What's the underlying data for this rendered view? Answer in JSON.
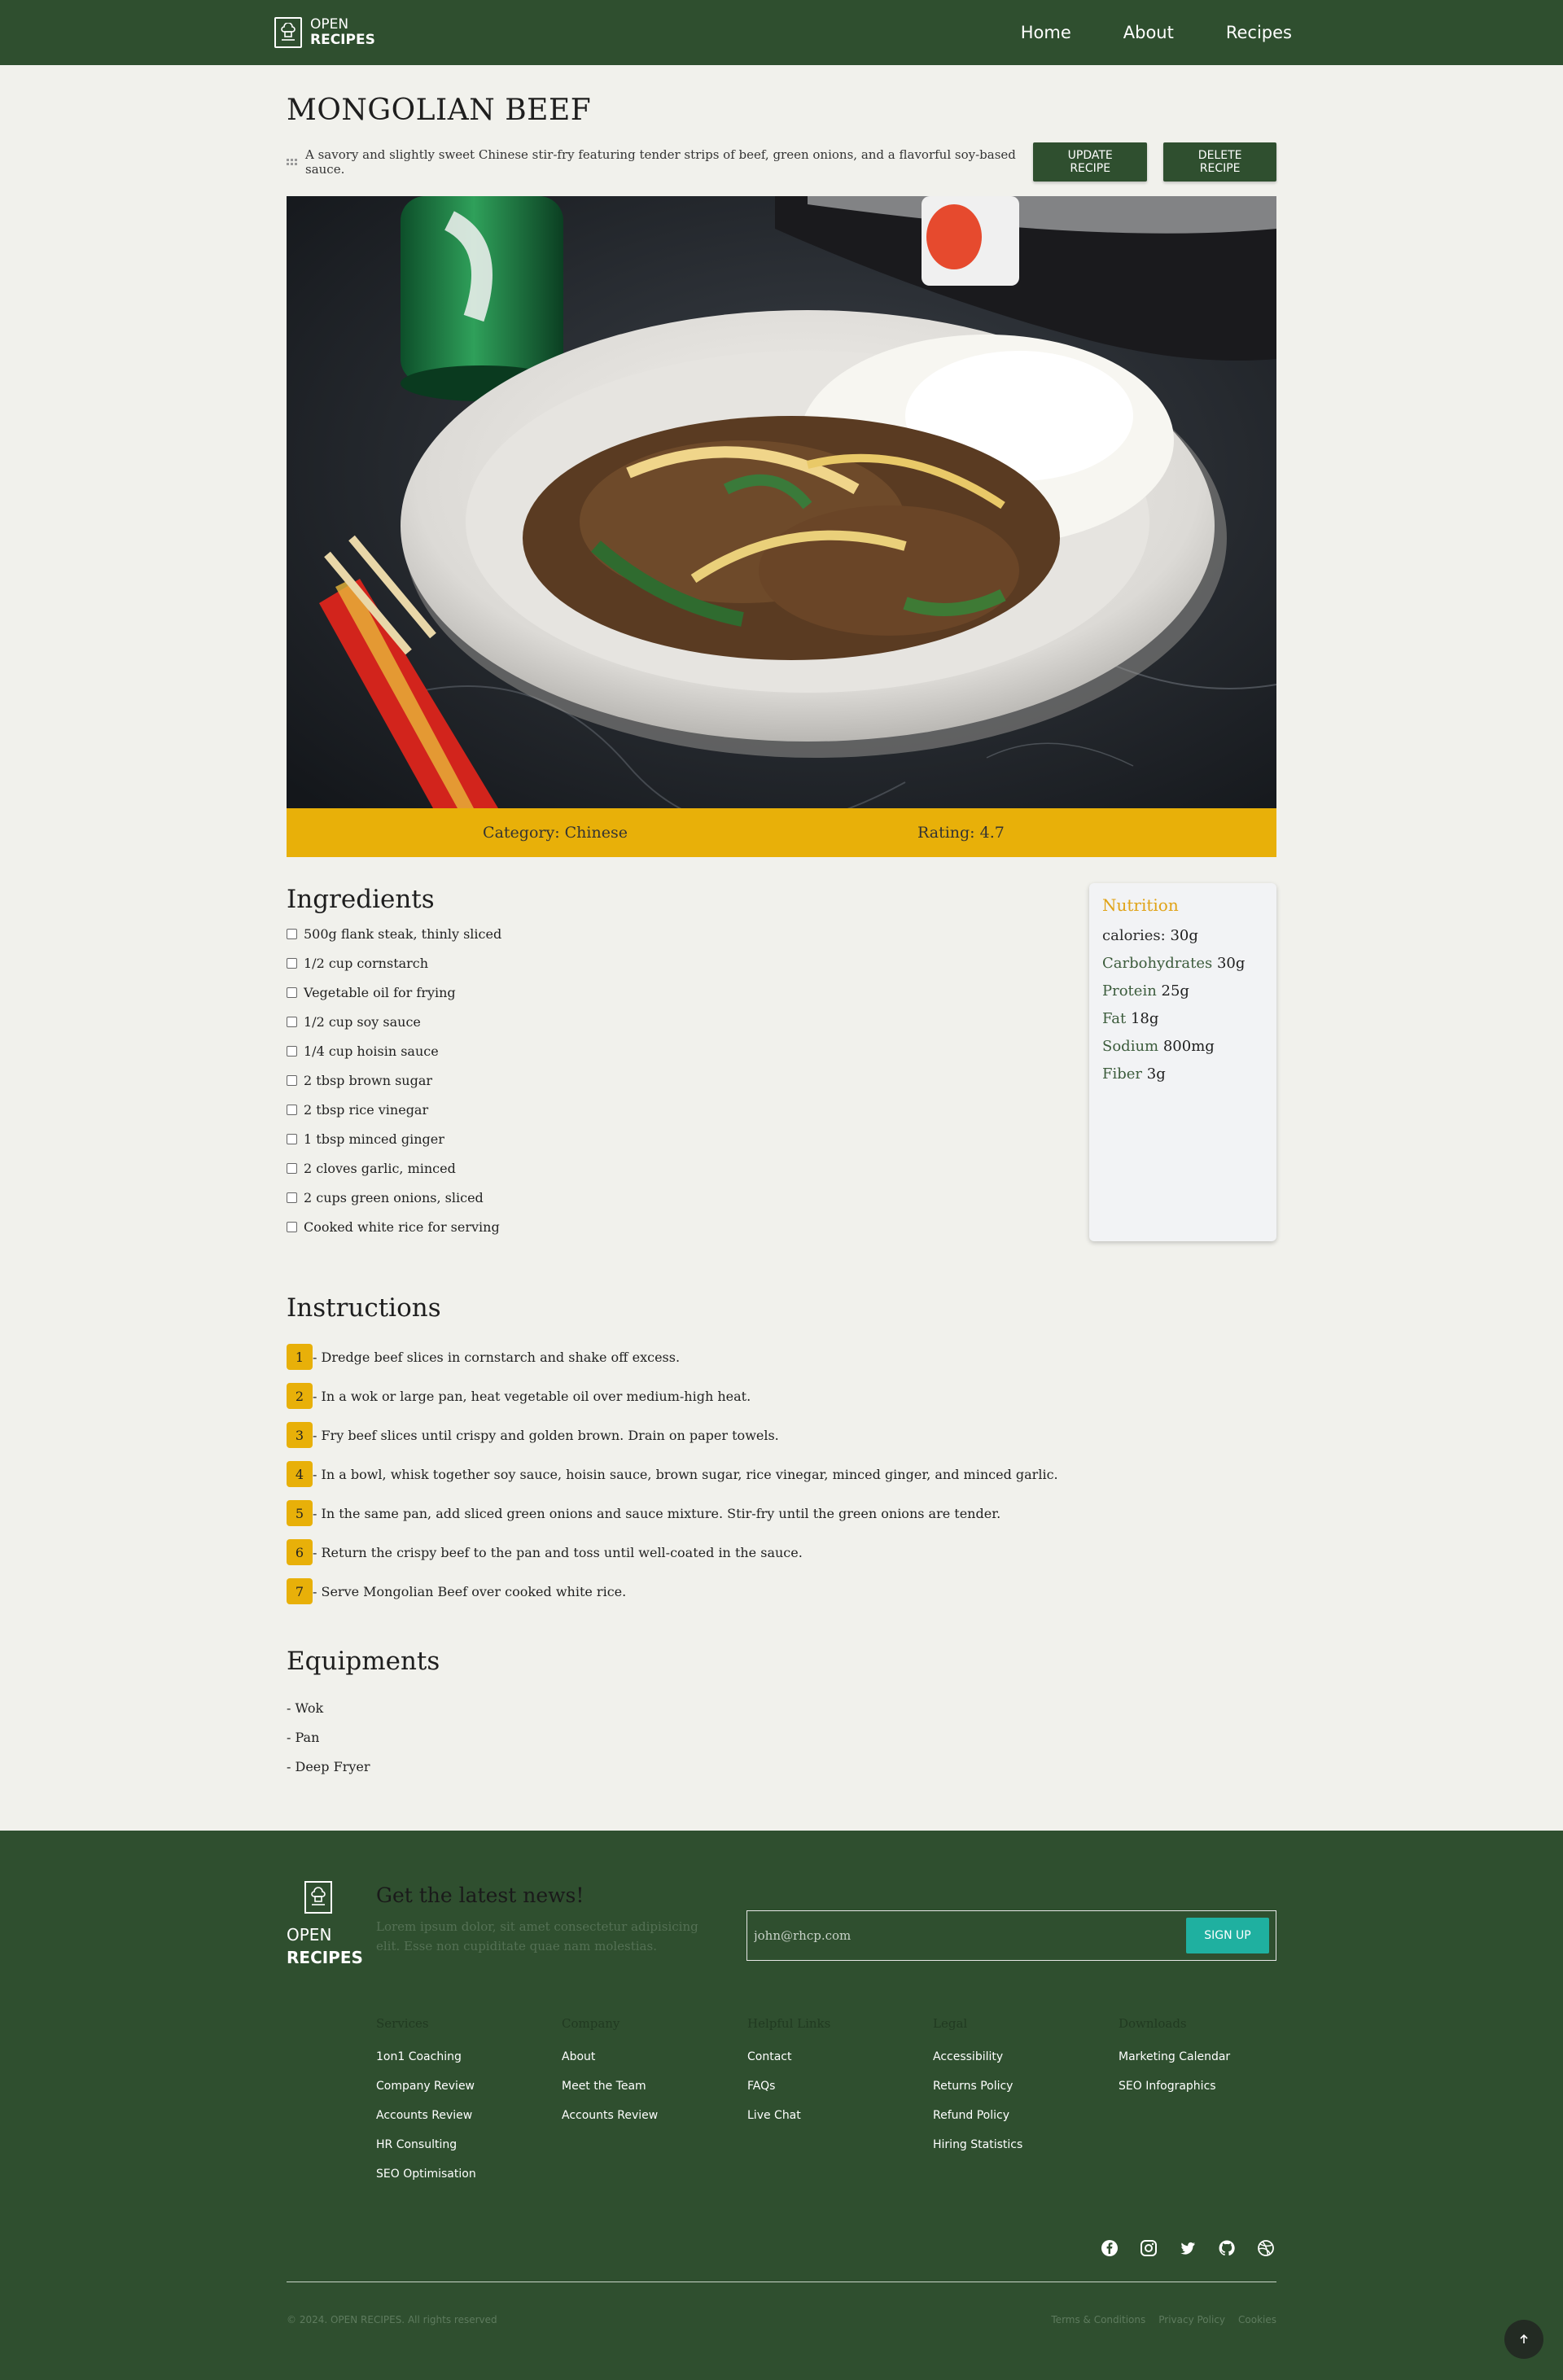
{
  "header": {
    "logo_line1": "OPEN",
    "logo_line2": "RECIPES",
    "nav": [
      "Home",
      "About",
      "Recipes"
    ]
  },
  "recipe": {
    "title": "MONGOLIAN BEEF",
    "description": "A savory and slightly sweet Chinese stir-fry featuring tender strips of beef, green onions, and a flavorful soy-based sauce.",
    "update_label": "UPDATE RECIPE",
    "delete_label": "DELETE RECIPE",
    "image_alt": "Mongolian beef with rice on a white plate",
    "category_text": "Category: Chinese",
    "rating_text": "Rating: 4.7"
  },
  "ingredients": {
    "title": "Ingredients",
    "items": [
      "500g flank steak, thinly sliced",
      "1/2 cup cornstarch",
      "Vegetable oil for frying",
      "1/2 cup soy sauce",
      "1/4 cup hoisin sauce",
      "2 tbsp brown sugar",
      "2 tbsp rice vinegar",
      "1 tbsp minced ginger",
      "2 cloves garlic, minced",
      "2 cups green onions, sliced",
      "Cooked white rice for serving"
    ]
  },
  "nutrition": {
    "title": "Nutrition",
    "rows": [
      {
        "label": "calories:",
        "value": "30g"
      },
      {
        "label": "Carbohydrates",
        "value": "30g"
      },
      {
        "label": "Protein",
        "value": "25g"
      },
      {
        "label": "Fat",
        "value": "18g"
      },
      {
        "label": "Sodium",
        "value": "800mg"
      },
      {
        "label": "Fiber",
        "value": "3g"
      }
    ]
  },
  "instructions": {
    "title": "Instructions",
    "steps": [
      {
        "num": "1",
        "text": "- Dredge beef slices in cornstarch and shake off excess."
      },
      {
        "num": "2",
        "text": "- In a wok or large pan, heat vegetable oil over medium-high heat."
      },
      {
        "num": "3",
        "text": "- Fry beef slices until crispy and golden brown. Drain on paper towels."
      },
      {
        "num": "4",
        "text": "- In a bowl, whisk together soy sauce, hoisin sauce, brown sugar, rice vinegar, minced ginger, and minced garlic."
      },
      {
        "num": "5",
        "text": "- In the same pan, add sliced green onions and sauce mixture. Stir-fry until the green onions are tender."
      },
      {
        "num": "6",
        "text": "- Return the crispy beef to the pan and toss until well-coated in the sauce."
      },
      {
        "num": "7",
        "text": "- Serve Mongolian Beef over cooked white rice."
      }
    ]
  },
  "equipments": {
    "title": "Equipments",
    "items": [
      "- Wok",
      "- Pan",
      "- Deep Fryer"
    ]
  },
  "footer": {
    "logo_line1": "OPEN",
    "logo_line2": "RECIPES",
    "news_title": "Get the latest news!",
    "news_text": "Lorem ipsum dolor, sit amet consectetur adipisicing elit. Esse non cupiditate quae nam molestias.",
    "email_placeholder": "john@rhcp.com",
    "signup_label": "SIGN UP",
    "columns": [
      {
        "title": "Services",
        "links": [
          "1on1 Coaching",
          "Company Review",
          "Accounts Review",
          "HR Consulting",
          "SEO Optimisation"
        ]
      },
      {
        "title": "Company",
        "links": [
          "About",
          "Meet the Team",
          "Accounts Review"
        ]
      },
      {
        "title": "Helpful Links",
        "links": [
          "Contact",
          "FAQs",
          "Live Chat"
        ]
      },
      {
        "title": "Legal",
        "links": [
          "Accessibility",
          "Returns Policy",
          "Refund Policy",
          "Hiring Statistics"
        ]
      },
      {
        "title": "Downloads",
        "links": [
          "Marketing Calendar",
          "SEO Infographics"
        ]
      }
    ],
    "socials": [
      "facebook-icon",
      "instagram-icon",
      "twitter-icon",
      "github-icon",
      "dribbble-icon"
    ],
    "copyright": "© 2024. OPEN RECIPES. All rights reserved",
    "legal_links": [
      "Terms & Conditions",
      "Privacy Policy",
      "Cookies"
    ]
  },
  "colors": {
    "brand_green": "#2f4f2f",
    "accent_yellow": "#e8b009",
    "signup_teal": "#1fb0a0"
  }
}
